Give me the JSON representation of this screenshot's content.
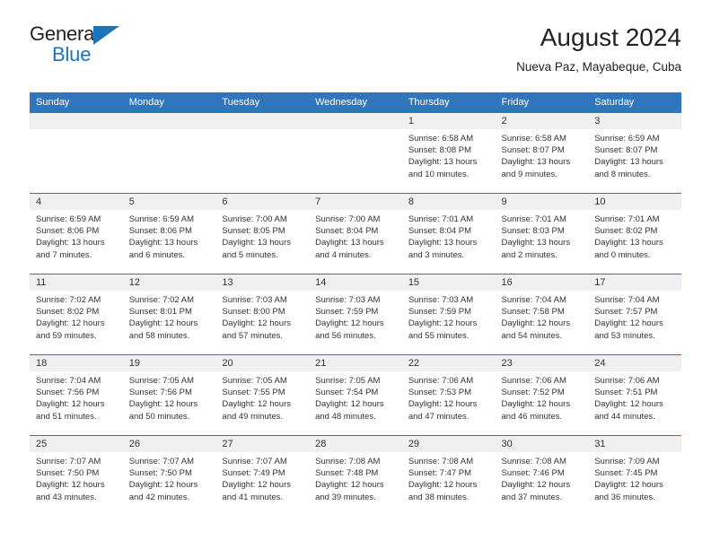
{
  "brand": {
    "name_part1": "General",
    "name_part2": "Blue",
    "triangle_color": "#1b75bc"
  },
  "header": {
    "title": "August 2024",
    "location": "Nueva Paz, Mayabeque, Cuba"
  },
  "theme": {
    "header_row_color": "#3176bc",
    "daynum_bg": "#f0f0f0",
    "text_color": "#333333"
  },
  "calendar": {
    "weekdays": [
      "Sunday",
      "Monday",
      "Tuesday",
      "Wednesday",
      "Thursday",
      "Friday",
      "Saturday"
    ],
    "weeks": [
      [
        {
          "day": "",
          "sunrise": "",
          "sunset": "",
          "daylight1": "",
          "daylight2": "",
          "empty": true
        },
        {
          "day": "",
          "sunrise": "",
          "sunset": "",
          "daylight1": "",
          "daylight2": "",
          "empty": true
        },
        {
          "day": "",
          "sunrise": "",
          "sunset": "",
          "daylight1": "",
          "daylight2": "",
          "empty": true
        },
        {
          "day": "",
          "sunrise": "",
          "sunset": "",
          "daylight1": "",
          "daylight2": "",
          "empty": true
        },
        {
          "day": "1",
          "sunrise": "Sunrise: 6:58 AM",
          "sunset": "Sunset: 8:08 PM",
          "daylight1": "Daylight: 13 hours",
          "daylight2": "and 10 minutes."
        },
        {
          "day": "2",
          "sunrise": "Sunrise: 6:58 AM",
          "sunset": "Sunset: 8:07 PM",
          "daylight1": "Daylight: 13 hours",
          "daylight2": "and 9 minutes."
        },
        {
          "day": "3",
          "sunrise": "Sunrise: 6:59 AM",
          "sunset": "Sunset: 8:07 PM",
          "daylight1": "Daylight: 13 hours",
          "daylight2": "and 8 minutes."
        }
      ],
      [
        {
          "day": "4",
          "sunrise": "Sunrise: 6:59 AM",
          "sunset": "Sunset: 8:06 PM",
          "daylight1": "Daylight: 13 hours",
          "daylight2": "and 7 minutes."
        },
        {
          "day": "5",
          "sunrise": "Sunrise: 6:59 AM",
          "sunset": "Sunset: 8:06 PM",
          "daylight1": "Daylight: 13 hours",
          "daylight2": "and 6 minutes."
        },
        {
          "day": "6",
          "sunrise": "Sunrise: 7:00 AM",
          "sunset": "Sunset: 8:05 PM",
          "daylight1": "Daylight: 13 hours",
          "daylight2": "and 5 minutes."
        },
        {
          "day": "7",
          "sunrise": "Sunrise: 7:00 AM",
          "sunset": "Sunset: 8:04 PM",
          "daylight1": "Daylight: 13 hours",
          "daylight2": "and 4 minutes."
        },
        {
          "day": "8",
          "sunrise": "Sunrise: 7:01 AM",
          "sunset": "Sunset: 8:04 PM",
          "daylight1": "Daylight: 13 hours",
          "daylight2": "and 3 minutes."
        },
        {
          "day": "9",
          "sunrise": "Sunrise: 7:01 AM",
          "sunset": "Sunset: 8:03 PM",
          "daylight1": "Daylight: 13 hours",
          "daylight2": "and 2 minutes."
        },
        {
          "day": "10",
          "sunrise": "Sunrise: 7:01 AM",
          "sunset": "Sunset: 8:02 PM",
          "daylight1": "Daylight: 13 hours",
          "daylight2": "and 0 minutes."
        }
      ],
      [
        {
          "day": "11",
          "sunrise": "Sunrise: 7:02 AM",
          "sunset": "Sunset: 8:02 PM",
          "daylight1": "Daylight: 12 hours",
          "daylight2": "and 59 minutes."
        },
        {
          "day": "12",
          "sunrise": "Sunrise: 7:02 AM",
          "sunset": "Sunset: 8:01 PM",
          "daylight1": "Daylight: 12 hours",
          "daylight2": "and 58 minutes."
        },
        {
          "day": "13",
          "sunrise": "Sunrise: 7:03 AM",
          "sunset": "Sunset: 8:00 PM",
          "daylight1": "Daylight: 12 hours",
          "daylight2": "and 57 minutes."
        },
        {
          "day": "14",
          "sunrise": "Sunrise: 7:03 AM",
          "sunset": "Sunset: 7:59 PM",
          "daylight1": "Daylight: 12 hours",
          "daylight2": "and 56 minutes."
        },
        {
          "day": "15",
          "sunrise": "Sunrise: 7:03 AM",
          "sunset": "Sunset: 7:59 PM",
          "daylight1": "Daylight: 12 hours",
          "daylight2": "and 55 minutes."
        },
        {
          "day": "16",
          "sunrise": "Sunrise: 7:04 AM",
          "sunset": "Sunset: 7:58 PM",
          "daylight1": "Daylight: 12 hours",
          "daylight2": "and 54 minutes."
        },
        {
          "day": "17",
          "sunrise": "Sunrise: 7:04 AM",
          "sunset": "Sunset: 7:57 PM",
          "daylight1": "Daylight: 12 hours",
          "daylight2": "and 53 minutes."
        }
      ],
      [
        {
          "day": "18",
          "sunrise": "Sunrise: 7:04 AM",
          "sunset": "Sunset: 7:56 PM",
          "daylight1": "Daylight: 12 hours",
          "daylight2": "and 51 minutes."
        },
        {
          "day": "19",
          "sunrise": "Sunrise: 7:05 AM",
          "sunset": "Sunset: 7:56 PM",
          "daylight1": "Daylight: 12 hours",
          "daylight2": "and 50 minutes."
        },
        {
          "day": "20",
          "sunrise": "Sunrise: 7:05 AM",
          "sunset": "Sunset: 7:55 PM",
          "daylight1": "Daylight: 12 hours",
          "daylight2": "and 49 minutes."
        },
        {
          "day": "21",
          "sunrise": "Sunrise: 7:05 AM",
          "sunset": "Sunset: 7:54 PM",
          "daylight1": "Daylight: 12 hours",
          "daylight2": "and 48 minutes."
        },
        {
          "day": "22",
          "sunrise": "Sunrise: 7:06 AM",
          "sunset": "Sunset: 7:53 PM",
          "daylight1": "Daylight: 12 hours",
          "daylight2": "and 47 minutes."
        },
        {
          "day": "23",
          "sunrise": "Sunrise: 7:06 AM",
          "sunset": "Sunset: 7:52 PM",
          "daylight1": "Daylight: 12 hours",
          "daylight2": "and 46 minutes."
        },
        {
          "day": "24",
          "sunrise": "Sunrise: 7:06 AM",
          "sunset": "Sunset: 7:51 PM",
          "daylight1": "Daylight: 12 hours",
          "daylight2": "and 44 minutes."
        }
      ],
      [
        {
          "day": "25",
          "sunrise": "Sunrise: 7:07 AM",
          "sunset": "Sunset: 7:50 PM",
          "daylight1": "Daylight: 12 hours",
          "daylight2": "and 43 minutes."
        },
        {
          "day": "26",
          "sunrise": "Sunrise: 7:07 AM",
          "sunset": "Sunset: 7:50 PM",
          "daylight1": "Daylight: 12 hours",
          "daylight2": "and 42 minutes."
        },
        {
          "day": "27",
          "sunrise": "Sunrise: 7:07 AM",
          "sunset": "Sunset: 7:49 PM",
          "daylight1": "Daylight: 12 hours",
          "daylight2": "and 41 minutes."
        },
        {
          "day": "28",
          "sunrise": "Sunrise: 7:08 AM",
          "sunset": "Sunset: 7:48 PM",
          "daylight1": "Daylight: 12 hours",
          "daylight2": "and 39 minutes."
        },
        {
          "day": "29",
          "sunrise": "Sunrise: 7:08 AM",
          "sunset": "Sunset: 7:47 PM",
          "daylight1": "Daylight: 12 hours",
          "daylight2": "and 38 minutes."
        },
        {
          "day": "30",
          "sunrise": "Sunrise: 7:08 AM",
          "sunset": "Sunset: 7:46 PM",
          "daylight1": "Daylight: 12 hours",
          "daylight2": "and 37 minutes."
        },
        {
          "day": "31",
          "sunrise": "Sunrise: 7:09 AM",
          "sunset": "Sunset: 7:45 PM",
          "daylight1": "Daylight: 12 hours",
          "daylight2": "and 36 minutes."
        }
      ]
    ]
  }
}
